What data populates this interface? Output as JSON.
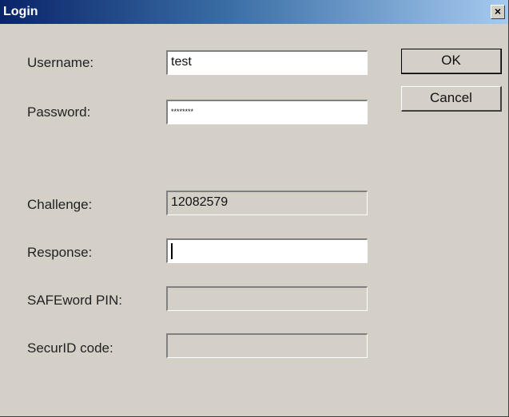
{
  "window": {
    "title": "Login",
    "close_glyph": "×"
  },
  "form": {
    "username": {
      "label": "Username:",
      "value": "test"
    },
    "password": {
      "label": "Password:",
      "value": "********"
    },
    "challenge": {
      "label": "Challenge:",
      "value": "12082579"
    },
    "response": {
      "label": "Response:",
      "value": ""
    },
    "safeword_pin": {
      "label": "SAFEword PIN:",
      "value": ""
    },
    "securid_code": {
      "label": "SecurID code:",
      "value": ""
    }
  },
  "buttons": {
    "ok": "OK",
    "cancel": "Cancel"
  },
  "icons": {
    "close": "close-icon"
  }
}
